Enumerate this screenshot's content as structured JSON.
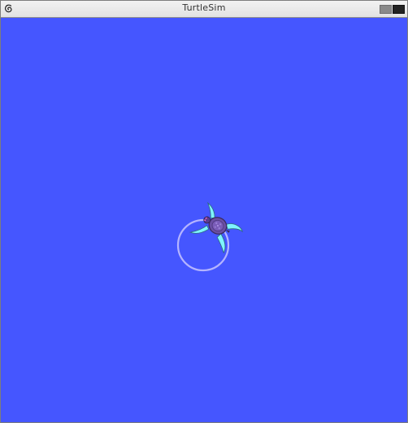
{
  "window": {
    "title": "TurtleSim"
  },
  "icons": {
    "window_menu": "debian-swirl-icon",
    "minimize": "minimize-icon",
    "maximize": "maximize-icon",
    "turtle": "turtle-icon"
  },
  "colors": {
    "background": "#4556ff",
    "path": "#b4b4ff",
    "titlebar": "#e6e6e6"
  }
}
